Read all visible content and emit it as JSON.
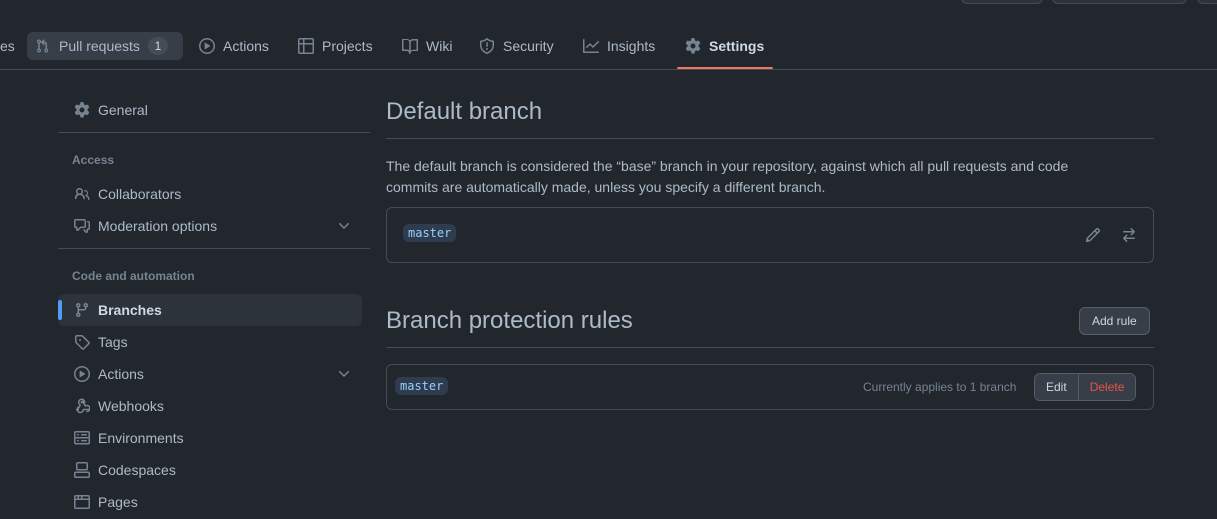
{
  "repo_nav": {
    "items": [
      {
        "label": "es",
        "icon": "code-icon"
      },
      {
        "label": "Pull requests",
        "icon": "git-pull-request-icon",
        "counter": "1"
      },
      {
        "label": "Actions",
        "icon": "play-icon"
      },
      {
        "label": "Projects",
        "icon": "table-icon"
      },
      {
        "label": "Wiki",
        "icon": "book-icon"
      },
      {
        "label": "Security",
        "icon": "shield-icon"
      },
      {
        "label": "Insights",
        "icon": "graph-icon"
      },
      {
        "label": "Settings",
        "icon": "gear-icon"
      }
    ],
    "selected": "Settings",
    "underline_color": "#ec775c"
  },
  "sidebar": {
    "general": {
      "label": "General",
      "icon": "gear-icon"
    },
    "access": {
      "heading": "Access",
      "items": [
        {
          "label": "Collaborators",
          "icon": "people-icon"
        },
        {
          "label": "Moderation options",
          "icon": "comment-discussion-icon",
          "expandable": true
        }
      ]
    },
    "code_automation": {
      "heading": "Code and automation",
      "items": [
        {
          "label": "Branches",
          "icon": "git-branch-icon",
          "active": true
        },
        {
          "label": "Tags",
          "icon": "tag-icon"
        },
        {
          "label": "Actions",
          "icon": "play-icon",
          "expandable": true
        },
        {
          "label": "Webhooks",
          "icon": "webhook-icon"
        },
        {
          "label": "Environments",
          "icon": "server-icon"
        },
        {
          "label": "Codespaces",
          "icon": "codespaces-icon"
        },
        {
          "label": "Pages",
          "icon": "browser-icon"
        }
      ]
    },
    "active_indicator_color": "#539bf5"
  },
  "default_branch": {
    "title": "Default branch",
    "description": "The default branch is considered the “base” branch in your repository, against which all pull requests and code commits are automatically made, unless you specify a different branch.",
    "branch": "master",
    "actions": [
      "pencil-icon",
      "arrow-switch-icon"
    ]
  },
  "protection": {
    "title": "Branch protection rules",
    "add_rule": "Add rule",
    "rules": [
      {
        "pattern": "master",
        "applies": "Currently applies to 1 branch",
        "edit": "Edit",
        "delete": "Delete"
      }
    ]
  },
  "colors": {
    "background": "#22272e",
    "border": "#444c56",
    "danger": "#e5534b",
    "branch_chip": "#96d0ff"
  }
}
